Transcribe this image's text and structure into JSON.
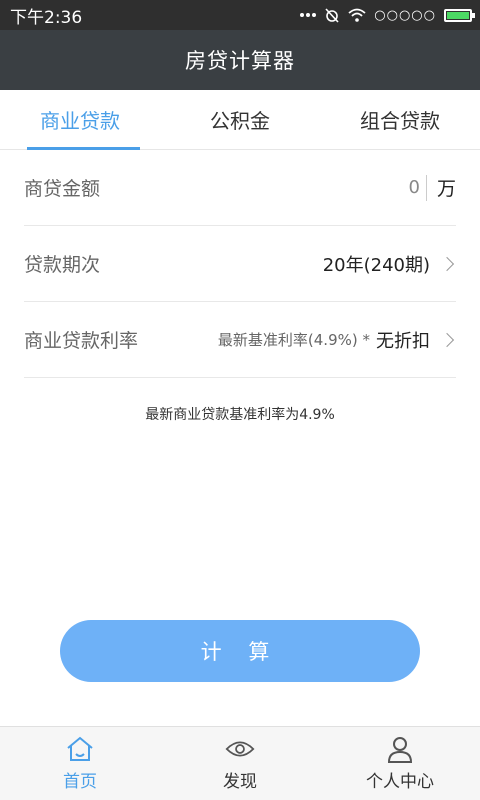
{
  "status_bar": {
    "time": "下午2:36",
    "signal": "○○○○○"
  },
  "header": {
    "title": "房贷计算器"
  },
  "tabs": [
    {
      "label": "商业贷款",
      "active": true
    },
    {
      "label": "公积金",
      "active": false
    },
    {
      "label": "组合贷款",
      "active": false
    }
  ],
  "form": {
    "amount": {
      "label": "商贷金额",
      "value": "0",
      "unit": "万"
    },
    "term": {
      "label": "贷款期次",
      "value": "20年(240期)"
    },
    "rate": {
      "label": "商业贷款利率",
      "base": "最新基准利率(4.9%) *",
      "discount": "无折扣"
    }
  },
  "hint": "最新商业贷款基准利率为4.9%",
  "calculate_button": "计 算",
  "bottom_nav": [
    {
      "label": "首页",
      "icon": "home-icon",
      "active": true
    },
    {
      "label": "发现",
      "icon": "eye-icon",
      "active": false
    },
    {
      "label": "个人中心",
      "icon": "user-icon",
      "active": false
    }
  ],
  "colors": {
    "accent": "#4a9fe8",
    "button": "#6eb1f7",
    "header": "#3a3f43"
  }
}
